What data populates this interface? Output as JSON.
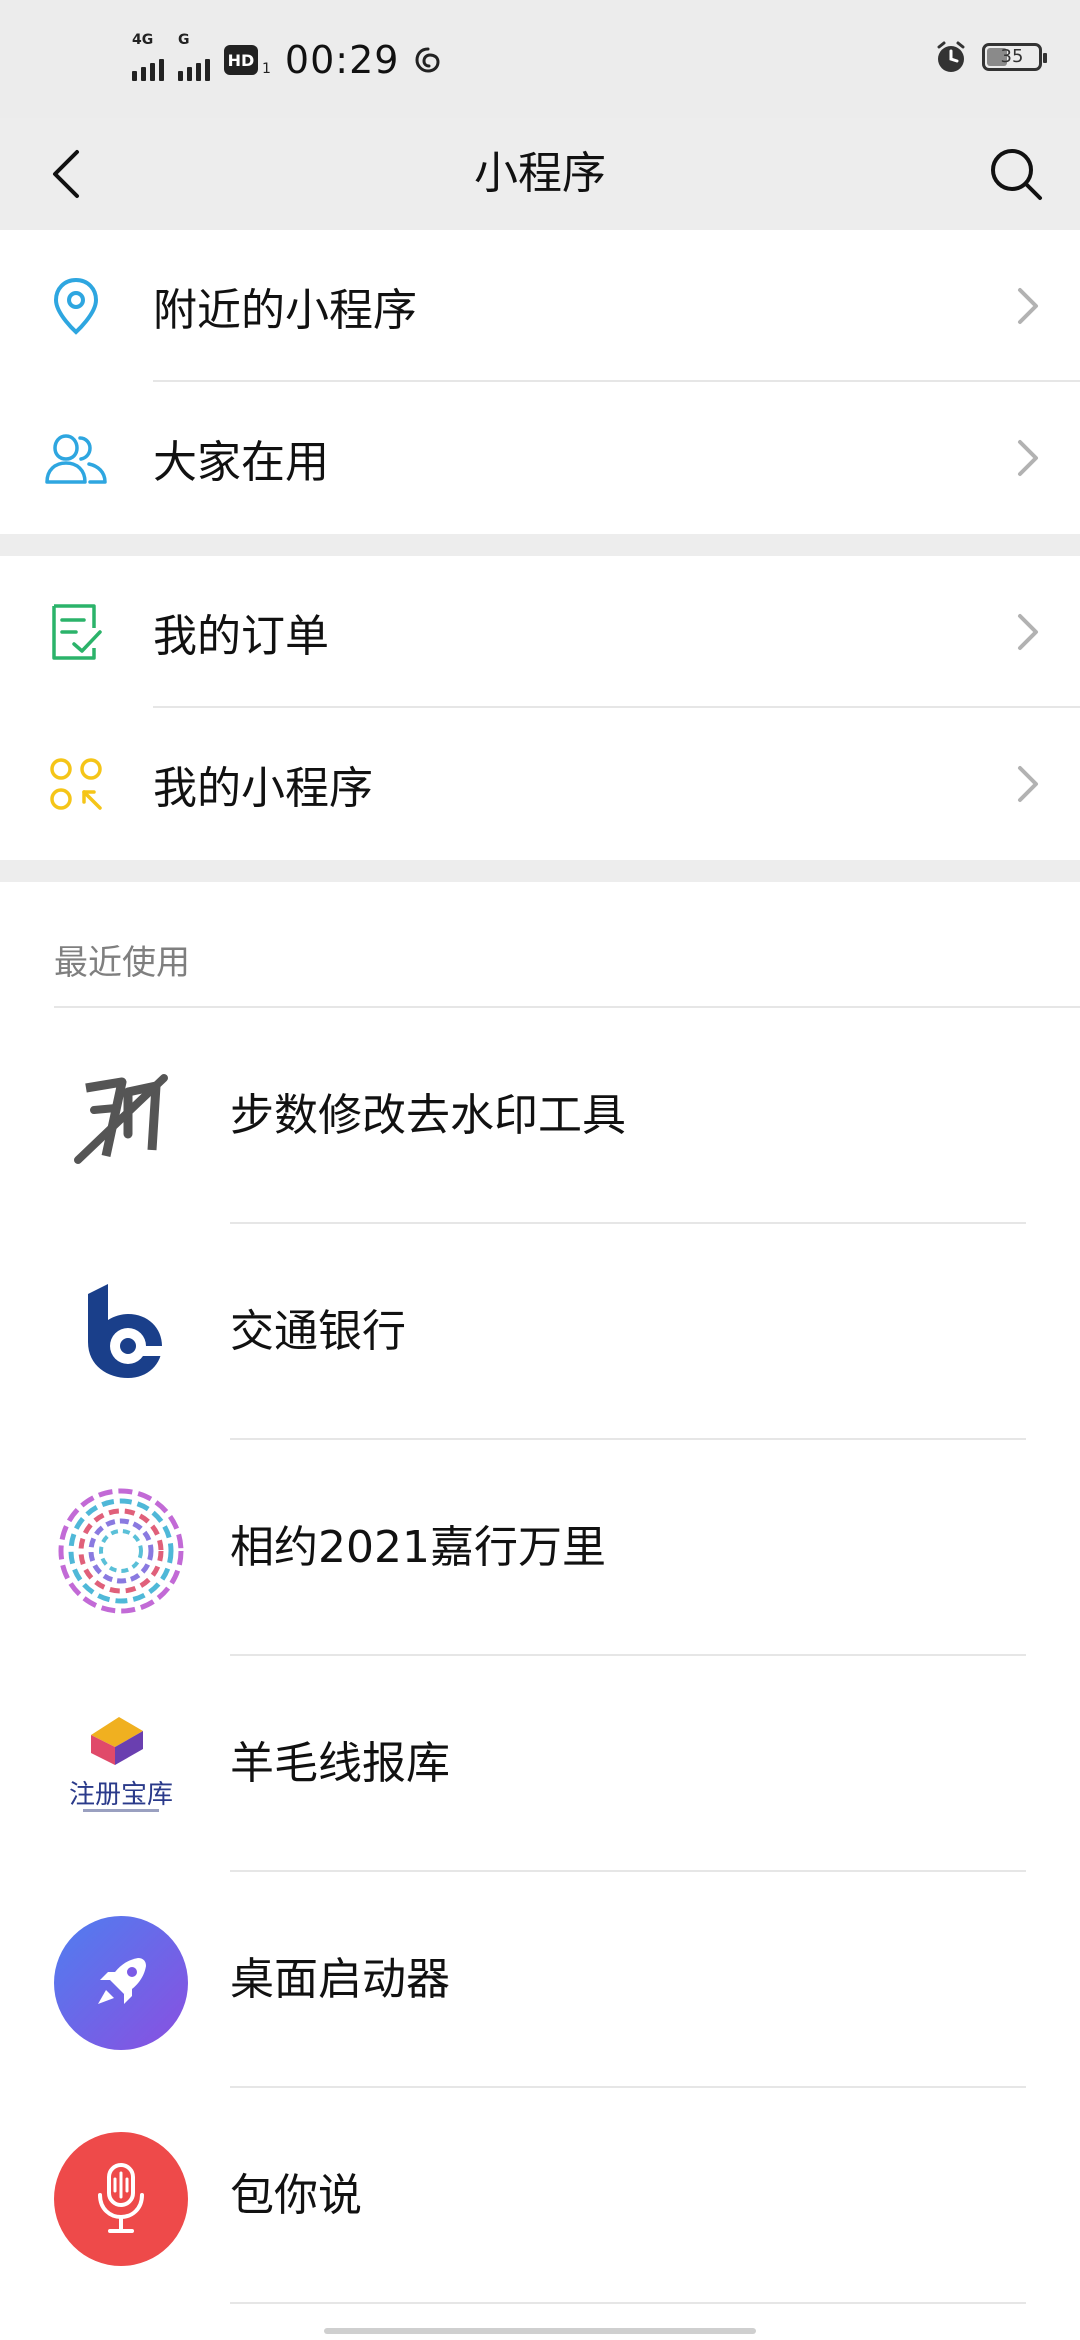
{
  "status_bar": {
    "signal1_label": "4G",
    "signal2_label": "G",
    "hd_label": "HD",
    "hd_sub": "1",
    "time": "00:29",
    "battery": "35"
  },
  "nav": {
    "title": "小程序"
  },
  "menu_group_1": [
    {
      "label": "附近的小程序",
      "icon": "location-pin-icon"
    },
    {
      "label": "大家在用",
      "icon": "users-icon"
    }
  ],
  "menu_group_2": [
    {
      "label": "我的订单",
      "icon": "order-checklist-icon"
    },
    {
      "label": "我的小程序",
      "icon": "my-mini-programs-icon"
    }
  ],
  "recent": {
    "header": "最近使用",
    "items": [
      {
        "label": "步数修改去水印工具"
      },
      {
        "label": "交通银行"
      },
      {
        "label": "相约2021嘉行万里"
      },
      {
        "label": "羊毛线报库"
      },
      {
        "label": "桌面启动器"
      },
      {
        "label": "包你说"
      }
    ],
    "logo4_text": "注册宝库"
  },
  "colors": {
    "nav_bg": "#ededed",
    "location_blue": "#2ea6e0",
    "users_blue": "#2ea6e0",
    "order_green": "#2bb36a",
    "mine_yellow": "#f5c518",
    "bank_navy": "#1a3f8a",
    "rocket_purple": "#7a4fe0",
    "mic_red": "#ee4a4a"
  }
}
